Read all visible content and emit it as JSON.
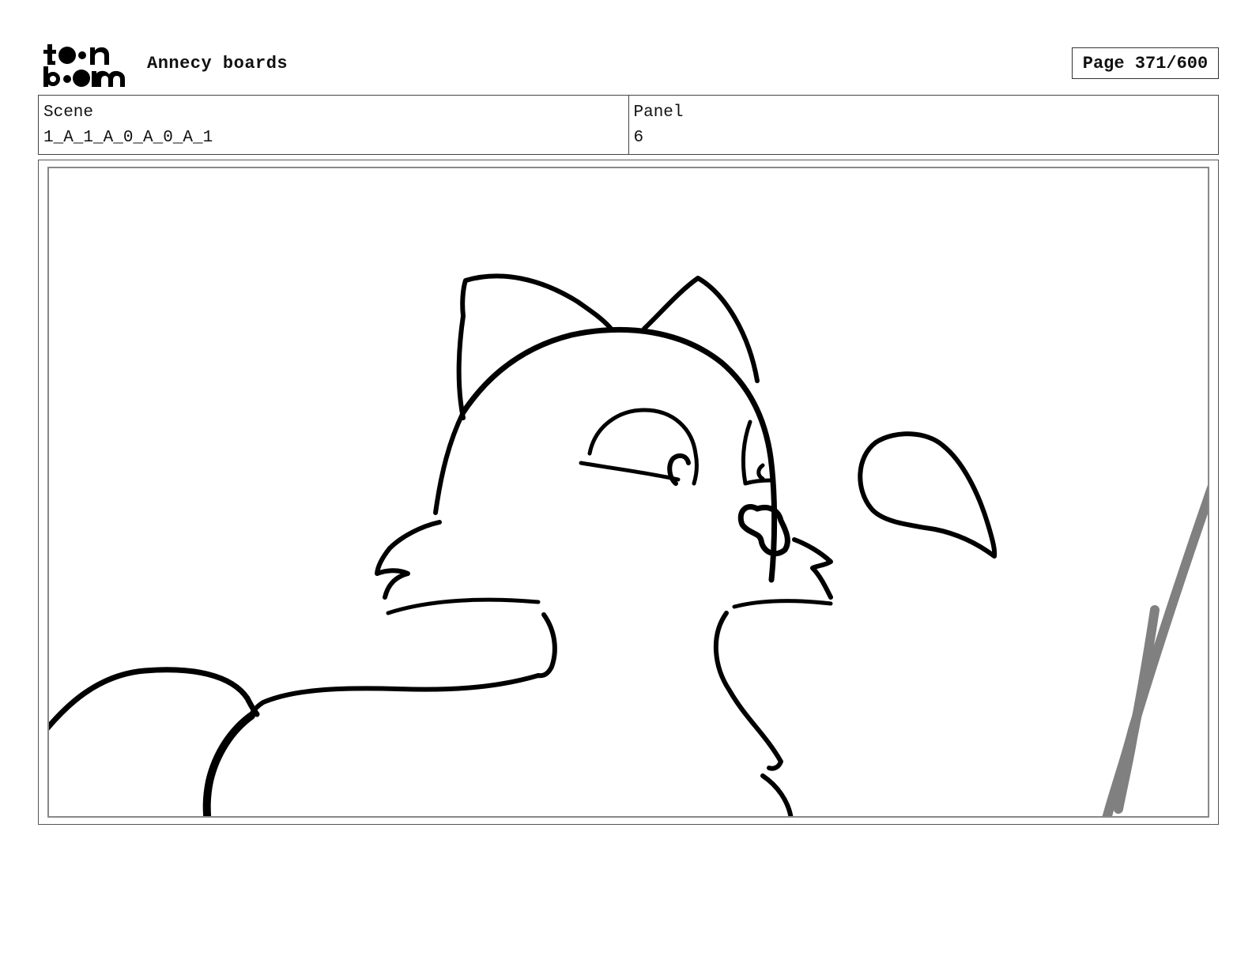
{
  "header": {
    "logo_alt": "toon boom",
    "project_title": "Annecy boards",
    "page_label": "Page 371/600"
  },
  "info": {
    "scene_label": "Scene",
    "scene_value": "1_A_1_A_0_A_0_A_1",
    "panel_label": "Panel",
    "panel_value": "6"
  },
  "colors": {
    "ink": "#000000",
    "grey_stroke": "#808080",
    "frame_border": "#888888"
  }
}
